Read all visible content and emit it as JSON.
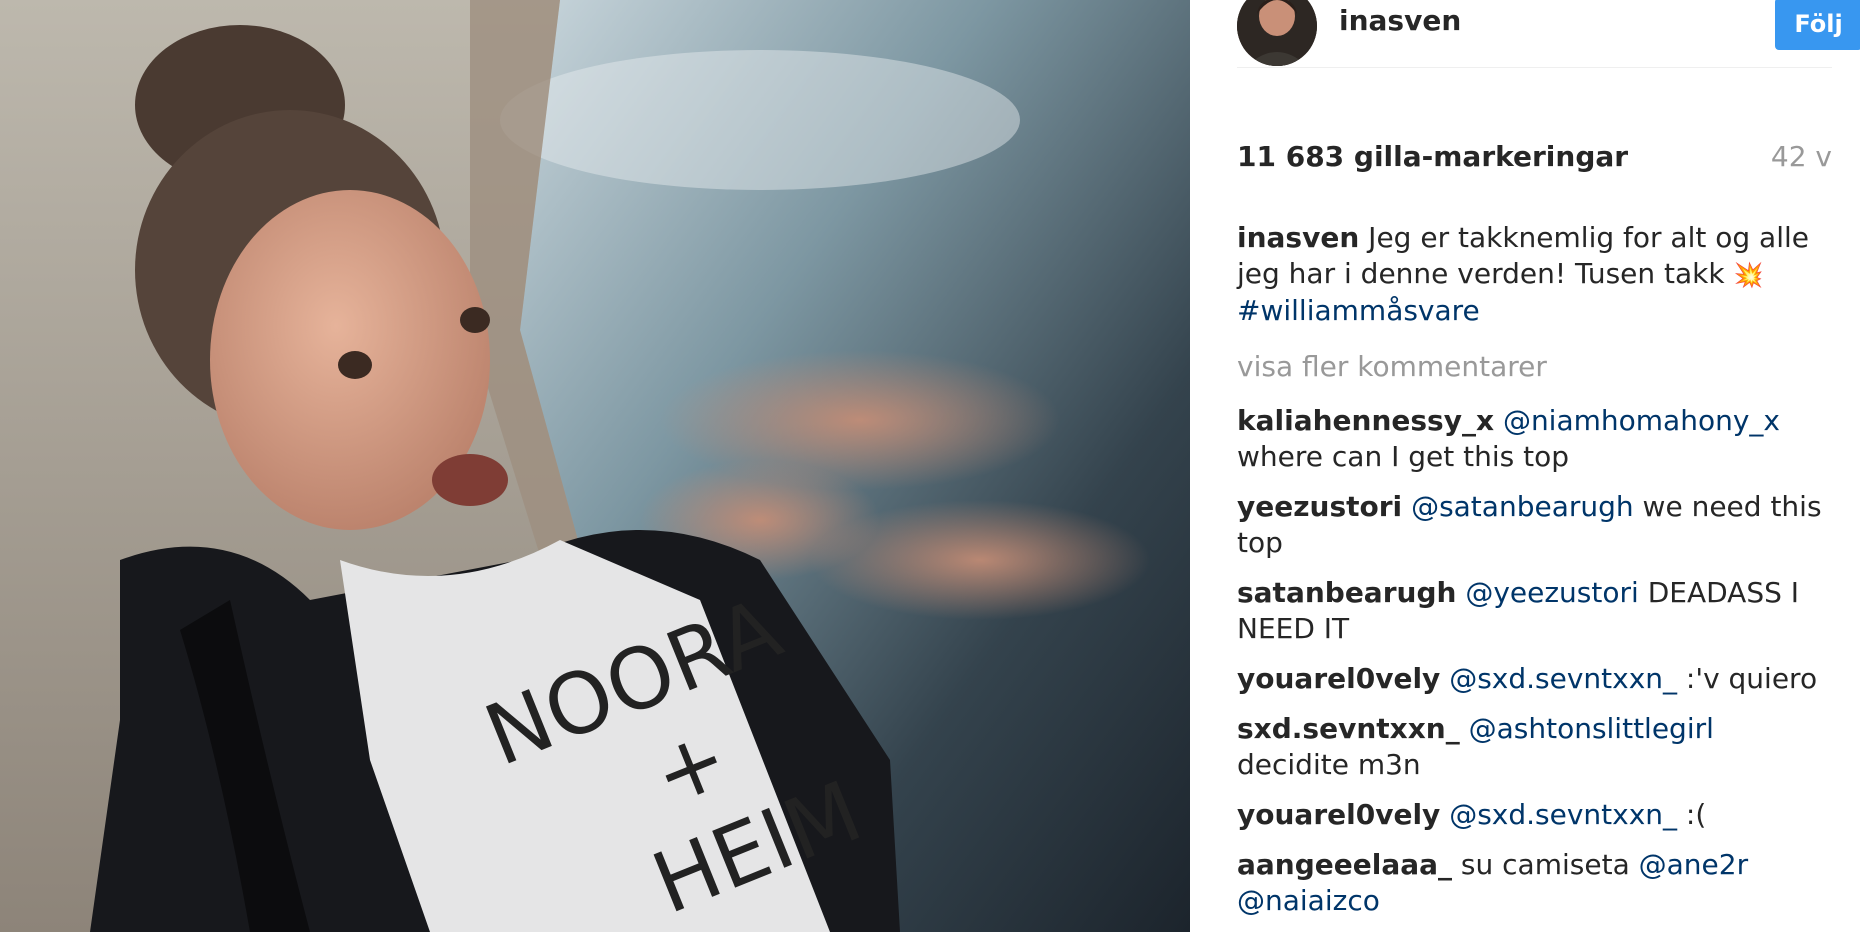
{
  "post": {
    "username": "inasven",
    "follow_label": "Följ",
    "likes_text": "11 683 gilla-markeringar",
    "age_text": "42 v",
    "caption": {
      "username": "inasven",
      "text": " Jeg er takknemlig for alt og alle jeg har i denne verden! Tusen takk ",
      "emoji": "💥",
      "hashtag": "#williammåsvare"
    },
    "shirt_text": {
      "line1": "NOORA",
      "line2": "+",
      "line3": "HEIM"
    },
    "more_comments_label": "visa fler kommentarer",
    "comments": [
      {
        "username": "kaliahennessy_x",
        "mention": "@niamhomahony_x",
        "text": " where can I get this top"
      },
      {
        "username": "yeezustori",
        "mention": "@satanbearugh",
        "text": " we need this top"
      },
      {
        "username": "satanbearugh",
        "mention": "@yeezustori",
        "text": " DEADASS I NEED IT"
      },
      {
        "username": "youarel0vely",
        "mention": "@sxd.sevntxxn_",
        "text": " :'v quiero"
      },
      {
        "username": "sxd.sevntxxn_",
        "mention": "@ashtonslittlegirl",
        "text": " decidite m3n"
      },
      {
        "username": "youarel0vely",
        "mention": "@sxd.sevntxxn_",
        "text": " :("
      },
      {
        "username": "aangeeelaaa_",
        "text": " su camiseta ",
        "mention": "@ane2r",
        "mention2": "@naiaizco"
      }
    ]
  },
  "colors": {
    "follow_button": "#3897f0",
    "link": "#003569",
    "muted": "#999999",
    "text": "#262626"
  }
}
